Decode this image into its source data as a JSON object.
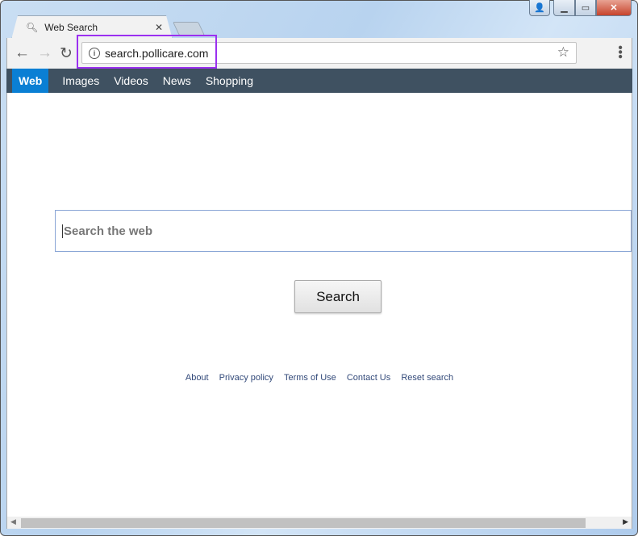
{
  "tab": {
    "title": "Web Search",
    "icon": "search-icon",
    "close": "✕"
  },
  "address": {
    "url": "search.pollicare.com"
  },
  "nav": {
    "items": [
      {
        "label": "Web",
        "active": true
      },
      {
        "label": "Images"
      },
      {
        "label": "Videos"
      },
      {
        "label": "News"
      },
      {
        "label": "Shopping"
      }
    ]
  },
  "search": {
    "placeholder": "Search the web",
    "button": "Search"
  },
  "footer": {
    "links": [
      "About",
      "Privacy policy",
      "Terms of Use",
      "Contact Us",
      "Reset search"
    ]
  },
  "colors": {
    "nav_bg": "#3f5161",
    "active_tab": "#0a7fd4",
    "highlight": "#9b30f0",
    "link": "#334a7a"
  }
}
